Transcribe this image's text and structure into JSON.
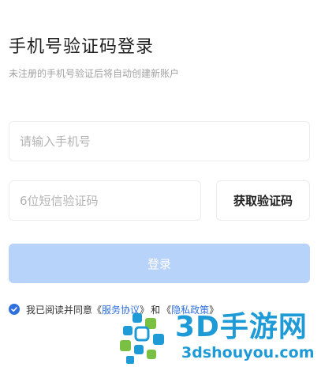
{
  "header": {
    "title": "手机号验证码登录",
    "subtitle": "未注册的手机号验证后将自动创建新账户"
  },
  "form": {
    "phone_placeholder": "请输入手机号",
    "code_placeholder": "6位短信验证码",
    "get_code_label": "获取验证码",
    "login_label": "登录"
  },
  "agreement": {
    "checked": true,
    "prefix": "我已阅读并同意",
    "open_quote": "《",
    "service_link": "服务协议",
    "close_quote": "》",
    "and": "和",
    "privacy_link": "隐私政策"
  },
  "watermark": {
    "brand": "3D手游网",
    "url": "3dshouyou.com"
  },
  "colors": {
    "accent": "#2f6fde",
    "login_disabled": "#b8d3f9",
    "watermark": "#1e9bd7"
  }
}
